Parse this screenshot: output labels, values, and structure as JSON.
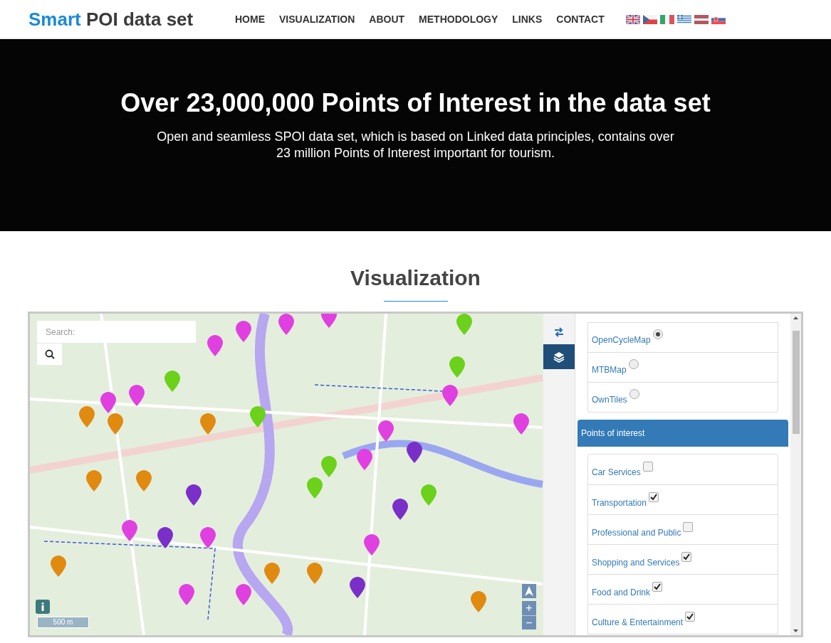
{
  "header": {
    "logo": {
      "brand": "Smart",
      "rest": "POI data set"
    },
    "nav": [
      {
        "label": "HOME"
      },
      {
        "label": "VISUALIZATION"
      },
      {
        "label": "ABOUT"
      },
      {
        "label": "METHODOLOGY"
      },
      {
        "label": "LINKS"
      },
      {
        "label": "CONTACT"
      }
    ]
  },
  "hero": {
    "title": "Over 23,000,000 Points of Interest in the data set",
    "subtitle": "Open and seamless SPOI data set, which is based on Linked data principles, contains over 23 million Points of Interest important for tourism."
  },
  "section": {
    "title": "Visualization"
  },
  "map": {
    "search": {
      "placeholder": "Search:"
    },
    "scale": "500 m",
    "zoom_in": "+",
    "zoom_out": "−"
  },
  "sidebar": {
    "tabs": [
      {
        "kind": "swap",
        "selected": false
      },
      {
        "kind": "layers",
        "selected": true
      }
    ],
    "base_layers": [
      {
        "label": "OpenCycleMap",
        "selected": true
      },
      {
        "label": "MTBMap",
        "selected": false
      },
      {
        "label": "OwnTiles",
        "selected": false
      }
    ],
    "poi_panel": {
      "title": "Points of interest",
      "categories": [
        {
          "label": "Car Services",
          "checked": false
        },
        {
          "label": "Transportation",
          "checked": true
        },
        {
          "label": "Professional and Public",
          "checked": false
        },
        {
          "label": "Shopping and Services",
          "checked": true
        },
        {
          "label": "Food and Drink",
          "checked": true
        },
        {
          "label": "Culture & Entertainment",
          "checked": true
        }
      ]
    }
  }
}
